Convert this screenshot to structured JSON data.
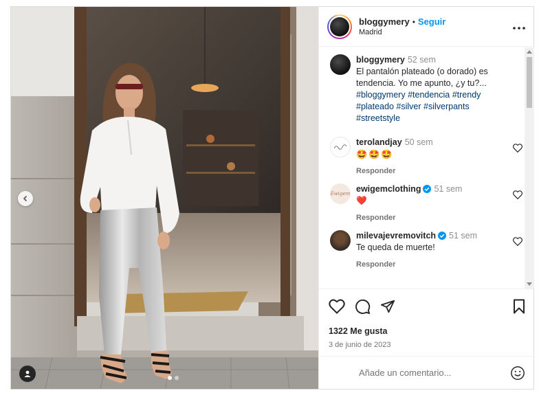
{
  "post": {
    "username": "bloggymery",
    "follow_label": "Seguir",
    "separator": "•",
    "location": "Madrid"
  },
  "caption": {
    "username": "bloggymery",
    "time": "52 sem",
    "text": "El pantalón plateado (o dorado) es tendencia. Yo me apunto, ¿y tu?...",
    "hashtags": [
      "#bloggymery",
      "#tendencia",
      "#trendy",
      "#plateado",
      "#silver",
      "#silverpants",
      "#streetstyle"
    ]
  },
  "comments": [
    {
      "username": "terolandjay",
      "time": "50 sem",
      "text": "🤩🤩🤩",
      "reply_label": "Responder",
      "verified": false
    },
    {
      "username": "ewigemclothing",
      "time": "51 sem",
      "text": "❤️",
      "reply_label": "Responder",
      "verified": true,
      "avatar_text": "Ewigem"
    },
    {
      "username": "milevajevremovitch",
      "time": "51 sem",
      "text": "Te queda de muerte!",
      "reply_label": "Responder",
      "verified": true
    }
  ],
  "stats": {
    "likes": "1322 Me gusta",
    "date": "3 de junio de 2023"
  },
  "composer": {
    "placeholder": "Añade un comentario..."
  },
  "icons": {
    "more": "more-horizontal-icon",
    "like": "heart-icon",
    "comment": "comment-bubble-icon",
    "share": "paper-plane-icon",
    "save": "bookmark-icon",
    "emoji": "emoji-smile-icon",
    "prev": "chevron-left-icon",
    "tags": "user-tag-icon"
  },
  "colors": {
    "accent": "#0095f6",
    "hashtag": "#00376b",
    "muted": "#737373",
    "verified": "#0095f6",
    "heart_red": "#ed4956"
  },
  "carousel": {
    "total_slides": 2,
    "active_slide": 1
  }
}
